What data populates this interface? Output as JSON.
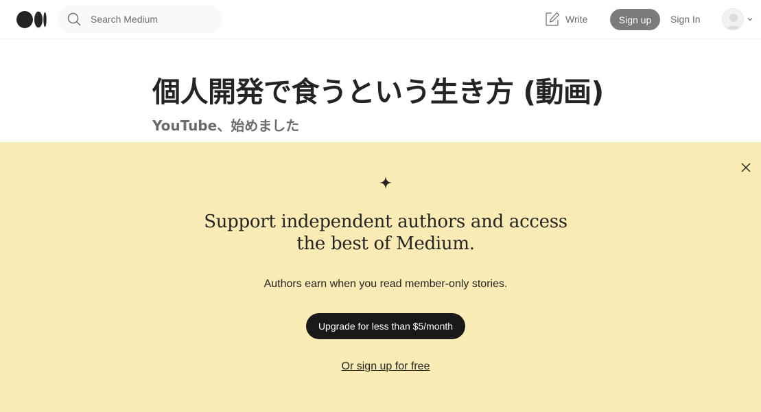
{
  "header": {
    "search": {
      "placeholder": "Search Medium",
      "value": ""
    },
    "write_label": "Write",
    "signup_label": "Sign up",
    "signin_label": "Sign In",
    "icons": [
      "medium-logo-icon",
      "search-icon",
      "write-icon",
      "avatar-icon",
      "chevron-down-icon"
    ]
  },
  "article": {
    "title": "個人開発で食うという生き方 (動画)",
    "subtitle": "YouTube、始めました"
  },
  "paywall": {
    "background_color": "#f9ebb4",
    "headline_line1": "Support independent authors and access",
    "headline_line2": "the best of Medium.",
    "body": "Authors earn when you read member-only stories.",
    "upgrade_label": "Upgrade for less than $5/month",
    "free_label": "Or sign up for free",
    "icons": [
      "close-icon",
      "sparkle-icon"
    ]
  }
}
